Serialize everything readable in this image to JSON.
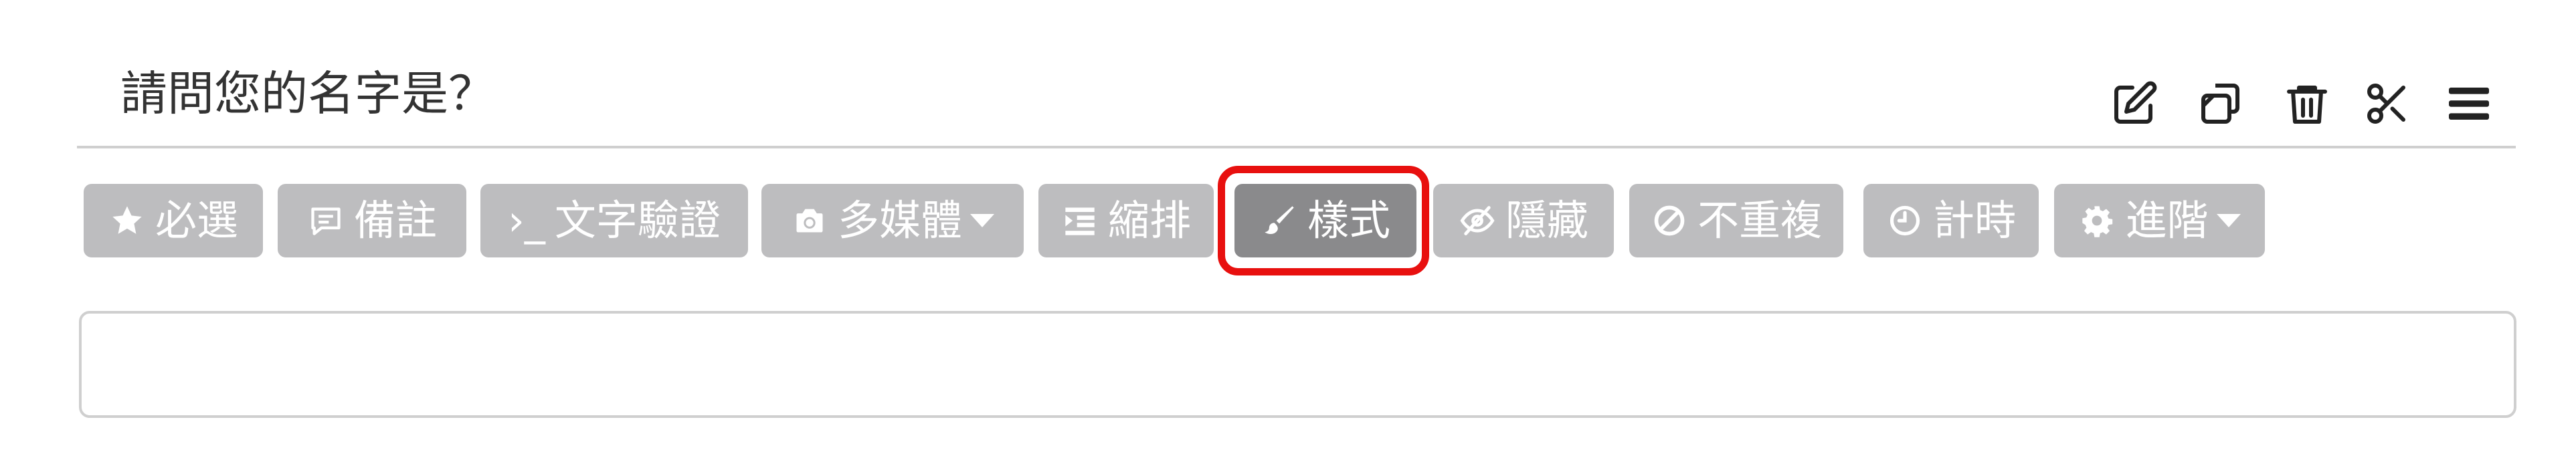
{
  "question": {
    "title": "請問您的名字是？"
  },
  "actions": [
    {
      "name": "edit-icon"
    },
    {
      "name": "duplicate-icon"
    },
    {
      "name": "trash-icon"
    },
    {
      "name": "scissors-icon"
    },
    {
      "name": "menu-icon"
    }
  ],
  "toolbar": {
    "required": "必選",
    "note": "備註",
    "validation_prefix": "›_",
    "validation": "文字驗證",
    "media": "多媒體",
    "indent": "縮排",
    "style": "樣式",
    "hide": "隱藏",
    "unique": "不重複",
    "timer": "計時",
    "advanced": "進階"
  },
  "answer": {
    "value": "",
    "placeholder": ""
  },
  "colors": {
    "button_bg": "#bdbdbf",
    "button_active_bg": "#8a8a8c",
    "highlight": "#e8100f",
    "title_text": "#333333"
  }
}
